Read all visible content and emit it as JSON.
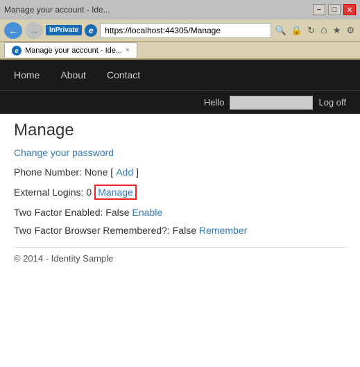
{
  "window": {
    "title": "Manage your account - Ide... ",
    "url": "https://localhost:44305/Manage"
  },
  "titlebar": {
    "minimize": "−",
    "maximize": "□",
    "close": "✕"
  },
  "addressbar": {
    "inprivate": "InPrivate",
    "search_placeholder": "https://localhost:44305/Manage",
    "back_icon": "←",
    "forward_icon": "→",
    "search_icon": "🔍",
    "lock_icon": "🔒",
    "refresh_icon": "↻",
    "home_icon": "⌂",
    "star_icon": "★",
    "gear_icon": "⚙"
  },
  "tab": {
    "favicon_label": "e",
    "title": "Manage your account - Ide...",
    "close": "×"
  },
  "nav": {
    "items": [
      {
        "label": "Home",
        "href": "/"
      },
      {
        "label": "About",
        "href": "/About"
      },
      {
        "label": "Contact",
        "href": "/Contact"
      }
    ]
  },
  "hellobar": {
    "hello_label": "Hello",
    "logoff_label": "Log off"
  },
  "main": {
    "page_title": "Manage",
    "change_password_label": "Change your password",
    "phone_row": {
      "label": "Phone Number: None [ ",
      "add_link": "Add",
      "after": " ]"
    },
    "external_logins_row": {
      "label": "External Logins: ",
      "count": "0 ",
      "manage_link": "Manage"
    },
    "two_factor_row": {
      "label": "Two Factor Enabled: False ",
      "enable_link": "Enable"
    },
    "browser_row": {
      "label": "Two Factor Browser Remembered?: False ",
      "remember_link": "Remember"
    }
  },
  "footer": {
    "text": "© 2014 - Identity Sample"
  }
}
